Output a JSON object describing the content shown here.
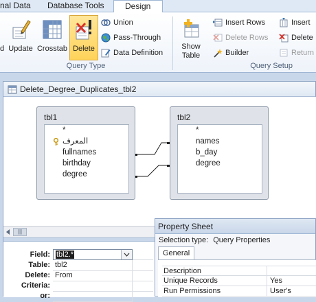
{
  "ribbon": {
    "tabs": [
      "nal Data",
      "Database Tools",
      "Design"
    ],
    "query_type": {
      "label": "Query Type",
      "buttons": {
        "make_table": "d",
        "update": "Update",
        "crosstab": "Crosstab",
        "delete": "Delete"
      },
      "small": {
        "union": "Union",
        "pass_through": "Pass-Through",
        "data_definition": "Data Definition"
      }
    },
    "query_setup": {
      "label": "Query Setup",
      "show_table": [
        "Show",
        "Table"
      ],
      "insert_rows": "Insert Rows",
      "delete_rows": "Delete Rows",
      "builder": "Builder",
      "insert_cols": "Insert",
      "delete_cols": "Delete",
      "return": "Return"
    }
  },
  "query_window": {
    "title": "Delete_Degree_Duplicates_tbl2",
    "tables": [
      {
        "name": "tbl1",
        "fields": [
          "*",
          "المعرف",
          "fullnames",
          "birthday",
          "degree"
        ]
      },
      {
        "name": "tbl2",
        "fields": [
          "*",
          "names",
          "b_day",
          "degree"
        ]
      }
    ],
    "scroll_glyph": "|||",
    "grid": {
      "row_labels": [
        "Field:",
        "Table:",
        "Delete:",
        "Criteria:",
        "or:"
      ],
      "column1": {
        "field": "tbl2.*",
        "table": "tbl2",
        "delete": "From"
      }
    }
  },
  "property_sheet": {
    "title": "Property Sheet",
    "selection_type_label": "Selection type:",
    "selection_type_value": "Query Properties",
    "tab": "General",
    "rows": [
      {
        "key": "Description",
        "value": ""
      },
      {
        "key": "Unique Records",
        "value": "Yes"
      },
      {
        "key": "Run Permissions",
        "value": "User's"
      }
    ]
  },
  "colors": {
    "accent": "#2b579a",
    "delete_selected": "#ffd35a"
  }
}
